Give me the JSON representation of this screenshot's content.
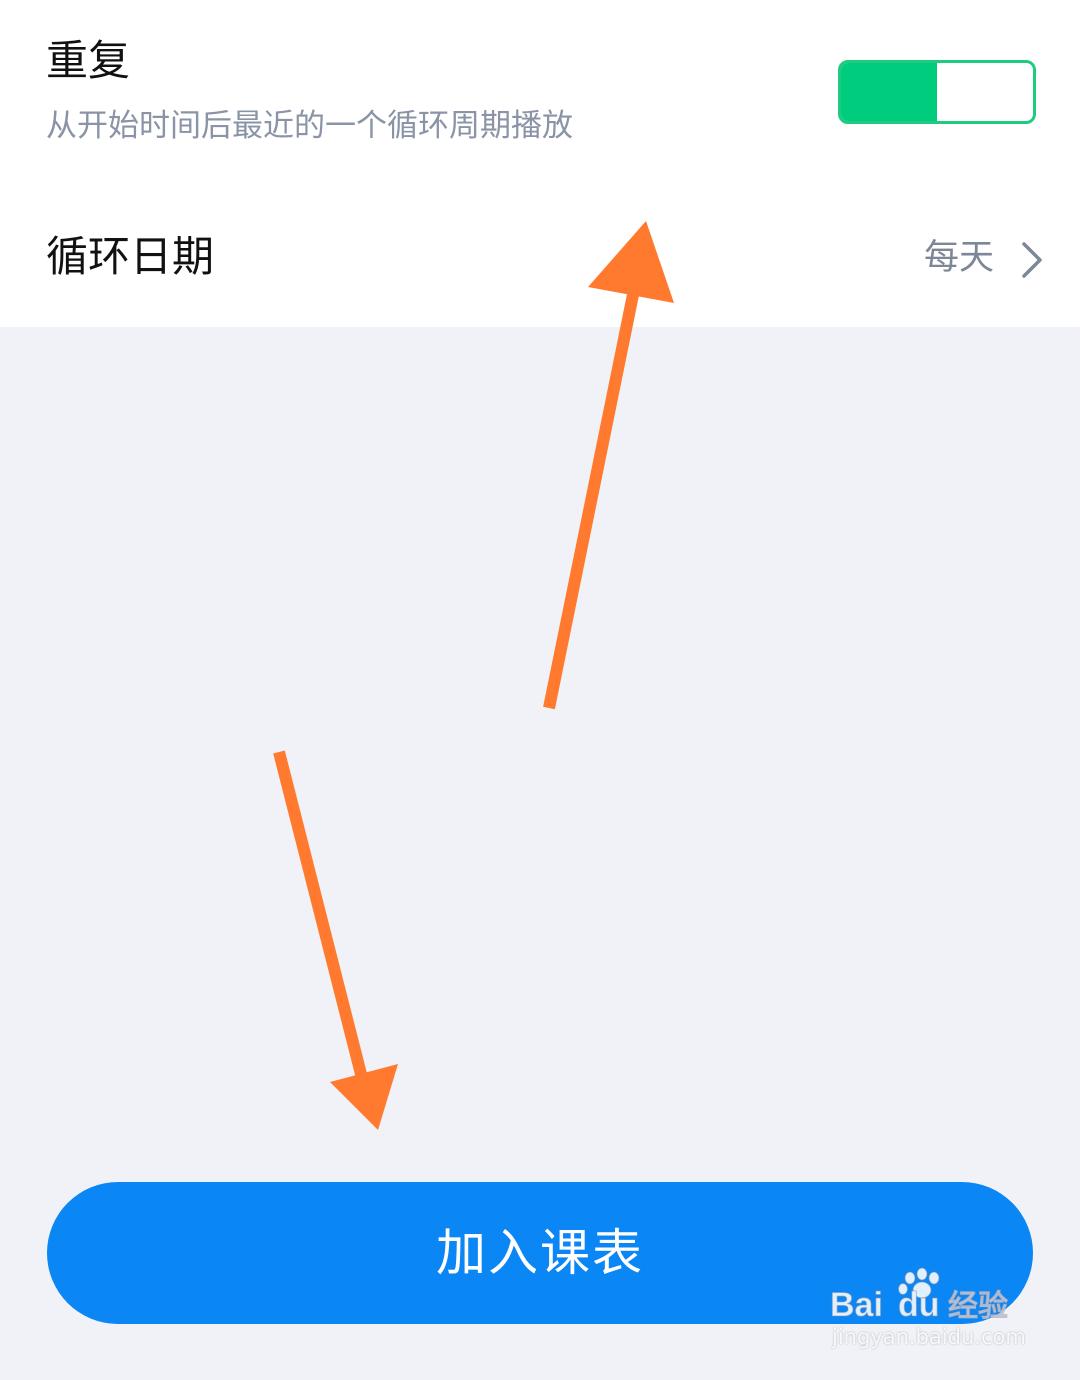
{
  "repeat": {
    "title": "重复",
    "description": "从开始时间后最近的一个循环周期播放",
    "toggle_on": true,
    "toggle_color": "#00cc7e"
  },
  "cycle": {
    "label": "循环日期",
    "value": "每天",
    "icon": "chevron-right-icon"
  },
  "add_button": {
    "label": "加入课表",
    "color": "#0a86f5"
  },
  "annotation": {
    "arrow_color": "#ff7a2e"
  },
  "watermark": {
    "logo_text": "Baidu经验",
    "url": "jingyan.baidu.com"
  }
}
